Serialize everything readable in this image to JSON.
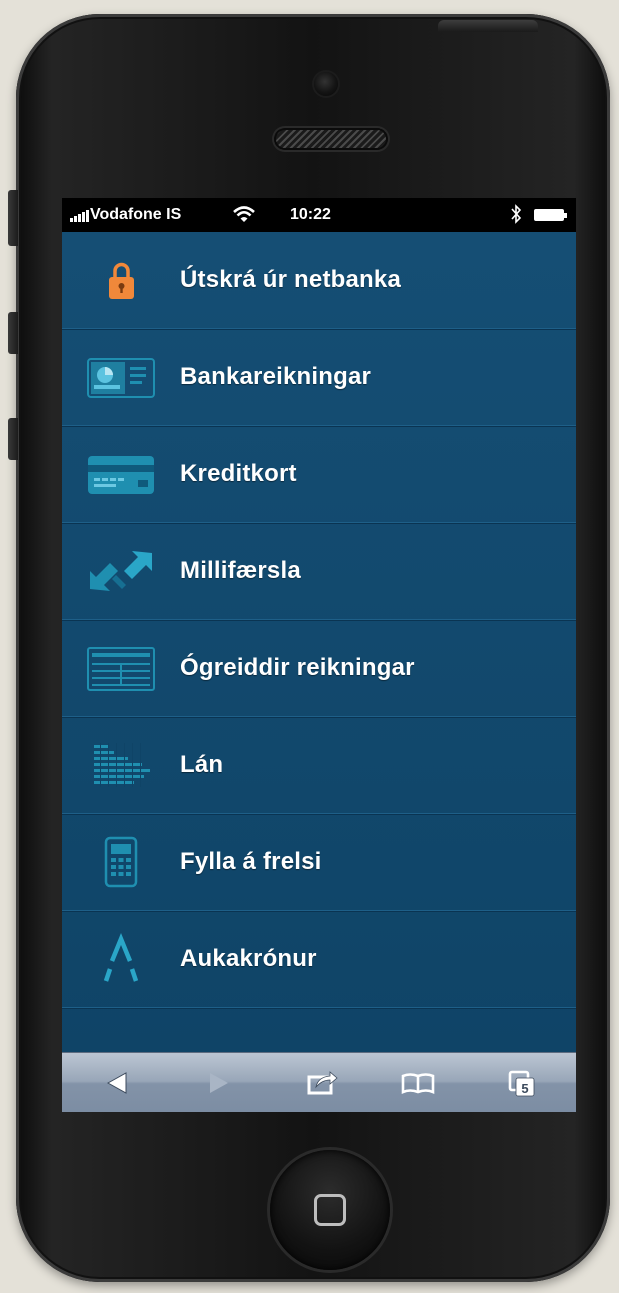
{
  "status_bar": {
    "carrier": "Vodafone IS",
    "time": "10:22"
  },
  "menu": {
    "items": [
      {
        "label": "Útskrá úr netbanka",
        "icon": "padlock-icon"
      },
      {
        "label": "Bankareikningar",
        "icon": "bank-account-card-icon"
      },
      {
        "label": "Kreditkort",
        "icon": "credit-card-icon"
      },
      {
        "label": "Millifærsla",
        "icon": "transfer-arrows-icon"
      },
      {
        "label": "Ógreiddir reikningar",
        "icon": "bill-icon"
      },
      {
        "label": "Lán",
        "icon": "loan-dots-icon"
      },
      {
        "label": "Fylla á frelsi",
        "icon": "mobile-phone-icon"
      },
      {
        "label": "Aukakrónur",
        "icon": "aukakronur-logo-icon"
      }
    ]
  },
  "toolbar": {
    "tabs_count": "5",
    "buttons": [
      "back-arrow-icon",
      "forward-arrow-icon",
      "share-icon",
      "bookmarks-book-icon",
      "tabs-icon"
    ]
  },
  "colors": {
    "menu_background": "#0f4a6e",
    "icon_teal": "#1f8fb0",
    "padlock_orange": "#f0883a",
    "toolbar": "#98a6b8"
  }
}
